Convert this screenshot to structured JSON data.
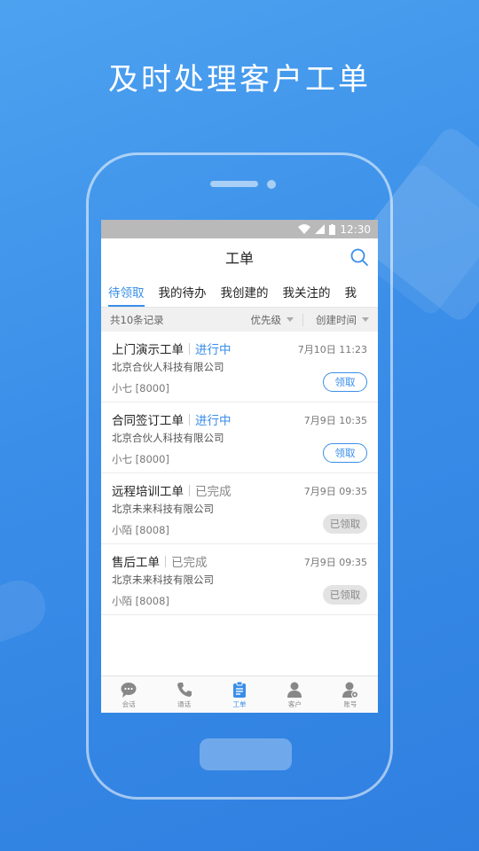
{
  "headline": "及时处理客户工单",
  "status_bar": {
    "time": "12:30"
  },
  "nav": {
    "title": "工单"
  },
  "tabs": [
    "待领取",
    "我的待办",
    "我创建的",
    "我关注的",
    "我"
  ],
  "filter": {
    "count": "共10条记录",
    "priority": "优先级",
    "created_time": "创建时间"
  },
  "items": [
    {
      "title": "上门演示工单",
      "status": "进行中",
      "company": "北京合伙人科技有限公司",
      "person": "小七 [8000]",
      "time": "7月10日 11:23",
      "button": "领取"
    },
    {
      "title": "合同签订工单",
      "status": "进行中",
      "company": "北京合伙人科技有限公司",
      "person": "小七 [8000]",
      "time": "7月9日 10:35",
      "button": "领取"
    },
    {
      "title": "远程培训工单",
      "status": "已完成",
      "company": "北京未来科技有限公司",
      "person": "小陌 [8008]",
      "time": "7月9日 09:35",
      "button": "已领取"
    },
    {
      "title": "售后工单",
      "status": "已完成",
      "company": "北京未来科技有限公司",
      "person": "小陌 [8008]",
      "time": "7月9日 09:35",
      "button": "已领取"
    }
  ],
  "bottom_nav": [
    {
      "label": "会话",
      "icon": "chat-icon"
    },
    {
      "label": "通话",
      "icon": "phone-icon"
    },
    {
      "label": "工单",
      "icon": "clipboard-icon"
    },
    {
      "label": "客户",
      "icon": "person-icon"
    },
    {
      "label": "账号",
      "icon": "account-settings-icon"
    }
  ],
  "colors": {
    "accent": "#3a8ee8",
    "background": "#3a8ee8"
  }
}
